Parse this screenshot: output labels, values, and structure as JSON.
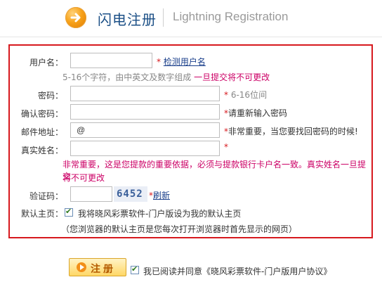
{
  "header": {
    "title": "闪电注册",
    "subtitle": "Lightning Registration"
  },
  "form": {
    "username": {
      "label": "用户名：",
      "value": "",
      "check_link": "检测用户名",
      "hint": "5-16个字符，由中英文及数字组成",
      "warning": "一旦提交将不可更改"
    },
    "password": {
      "label": "密码：",
      "value": "",
      "hint": "6-16位间"
    },
    "confirm_password": {
      "label": "确认密码：",
      "value": "",
      "hint": "请重新输入密码"
    },
    "email": {
      "label": "邮件地址：",
      "value": "@",
      "hint": "非常重要，当您要找回密码的时候!"
    },
    "realname": {
      "label": "真实姓名：",
      "value": "",
      "warning_line1": "非常重要，这是您提款的重要依据，必须与提款银行卡户名一致。真实姓名一旦提交",
      "warning_line2": "将不可更改"
    },
    "captcha": {
      "label": "验证码：",
      "value": "",
      "code": "6452",
      "refresh": "刷新"
    },
    "homepage": {
      "label": "默认主页：",
      "checked": true,
      "text": "我将晓风彩票软件-门户版设为我的默认主页",
      "note": "（您浏览器的默认主页是您每次打开浏览器时首先显示的网页）"
    },
    "required_mark": "*"
  },
  "submit": {
    "label": "注册",
    "agree_checked": true,
    "agree_text": "我已阅读并同意《晓风彩票软件-门户版用户协议》"
  },
  "colors": {
    "accent_red": "#d7191e",
    "warning_pink": "#cc0066",
    "link_blue": "#1a3f8b",
    "title_blue": "#1b4f86"
  }
}
